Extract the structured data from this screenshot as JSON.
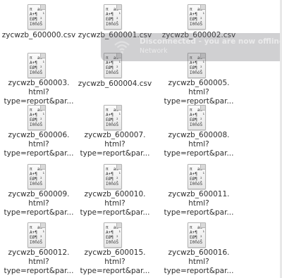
{
  "icon_glyph_lines": [
    "π  aé",
    "A+¶  ¹",
    "EØ¶ ²",
    "I0ñóŠ"
  ],
  "files": [
    {
      "name": "zycwzb_600000.csv"
    },
    {
      "name": "zycwzb_600001.csv"
    },
    {
      "name": "zycwzb_600002.csv"
    },
    {
      "name": "zycwzb_600003.\nhtml?\ntype=report&par..."
    },
    {
      "name": "zycwzb_600004.csv"
    },
    {
      "name": "zycwzb_600005.\nhtml?\ntype=report&par..."
    },
    {
      "name": "zycwzb_600006.\nhtml?\ntype=report&par..."
    },
    {
      "name": "zycwzb_600007.\nhtml?\ntype=report&par..."
    },
    {
      "name": "zycwzb_600008.\nhtml?\ntype=report&par..."
    },
    {
      "name": "zycwzb_600009.\nhtml?\ntype=report&par..."
    },
    {
      "name": "zycwzb_600010.\nhtml?\ntype=report&par..."
    },
    {
      "name": "zycwzb_600011.\nhtml?\ntype=report&par..."
    },
    {
      "name": "zycwzb_600012.\nhtml?\ntype=report&par..."
    },
    {
      "name": "zycwzb_600015.\nhtml?\ntype=report&par..."
    },
    {
      "name": "zycwzb_600016.\nhtml?\ntype=report&par..."
    }
  ],
  "notification": {
    "title": "Disconnected - you are now offline",
    "body": "Network",
    "icon": "wifi-icon"
  }
}
